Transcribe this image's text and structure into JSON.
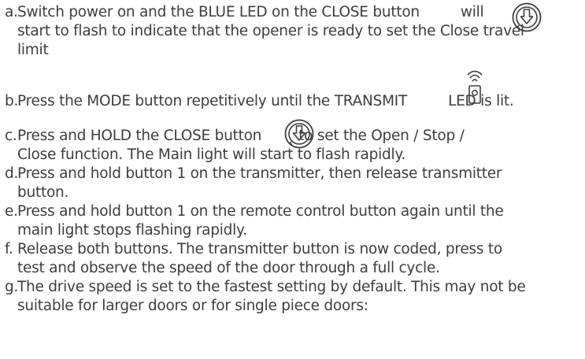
{
  "steps": [
    {
      "letter": "a.",
      "lines": [
        "Switch power on and the BLUE LED on the CLOSE button",
        "will",
        "start to flash to indicate that the opener is ready to set the Close travel",
        "limit"
      ]
    },
    {
      "letter": "b.",
      "lines": [
        "Press the MODE button repetitively until the TRANSMIT",
        "LED is lit."
      ]
    },
    {
      "letter": "c.",
      "lines": [
        "Press and HOLD the CLOSE button",
        "to set the Open / Stop  /",
        "Close function. The Main light will start to flash rapidly."
      ]
    },
    {
      "letter": "d.",
      "lines": [
        "Press and hold button 1 on the transmitter, then release transmitter",
        "button."
      ]
    },
    {
      "letter": "e.",
      "lines": [
        "Press and hold button 1 on the remote control button again until the",
        "main light stops flashing rapidly."
      ]
    },
    {
      "letter": "f.",
      "lines": [
        "Release both buttons. The transmitter button is now coded, press to",
        "test and observe the speed of the door through a full cycle."
      ]
    },
    {
      "letter": "g.",
      "lines": [
        "The drive speed is set to the fastest setting by default. This may not be",
        "suitable for larger doors or for single piece doors:"
      ]
    }
  ],
  "icons": {
    "close_button_icon": "close-down-arrow-button",
    "transmit_led_icon": "transmit-led-signal"
  }
}
